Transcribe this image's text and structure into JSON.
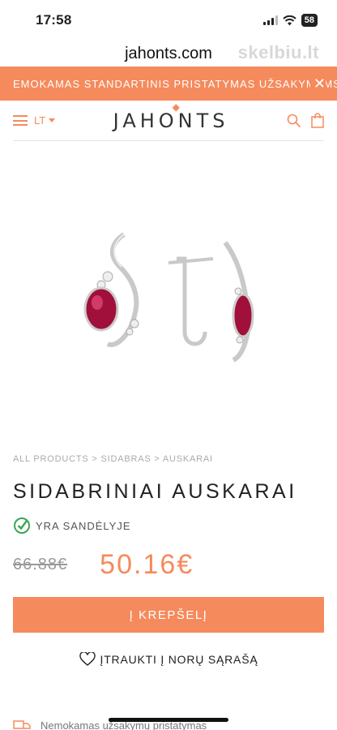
{
  "status_bar": {
    "time": "17:58",
    "battery": "58"
  },
  "browser": {
    "url": "jahonts.com",
    "watermark": "skelbiu.lt"
  },
  "promo": {
    "text": "EMOKAMAS STANDARTINIS PRISTATYMAS UŽSAKYMAMS"
  },
  "header": {
    "language": "LT",
    "logo": "JAHONTS"
  },
  "product": {
    "breadcrumb": "ALL PRODUCTS > SIDABRAS > AUSKARAI",
    "title": "SIDABRINIAI AUSKARAI",
    "stock": "YRA SANDĖLYJE",
    "old_price": "66.88€",
    "price": "50.16€",
    "add_to_cart": "Į KREPŠELĮ",
    "wishlist": "ĮTRAUKTI Į NORŲ SĄRAŠĄ"
  },
  "footer_peek": {
    "text": "Nemokamas užsakymų pristatymas"
  },
  "colors": {
    "accent": "#f58a5c",
    "stone": "#a0103a",
    "stock_green": "#3aa655"
  },
  "icons": [
    "hamburger-menu-icon",
    "caret-down-icon",
    "search-icon",
    "shopping-bag-icon",
    "check-circle-icon",
    "heart-icon",
    "delivery-truck-icon",
    "close-icon"
  ]
}
